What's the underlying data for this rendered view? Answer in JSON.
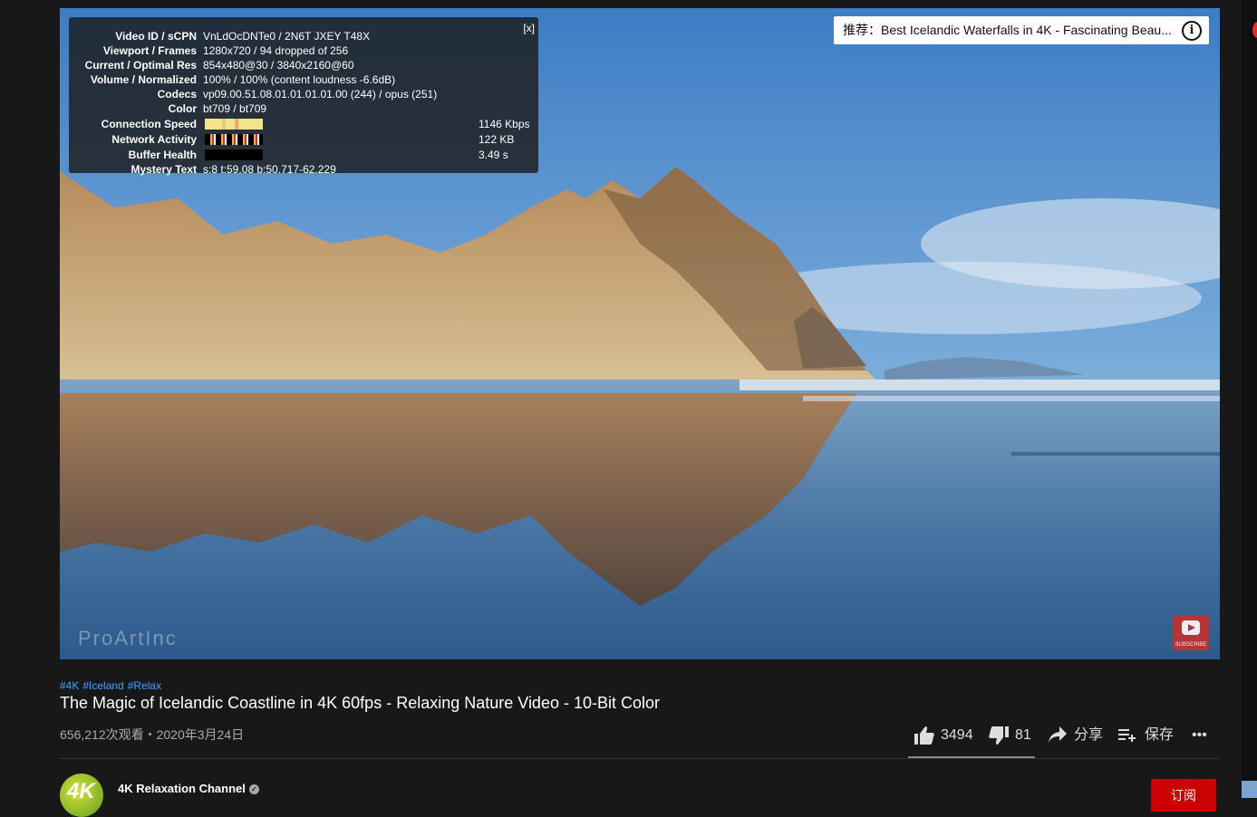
{
  "stats_panel": {
    "close_label": "[x]",
    "rows": [
      {
        "key": "Video ID / sCPN",
        "value": "VnLdOcDNTe0 / 2N6T JXEY T48X"
      },
      {
        "key": "Viewport / Frames",
        "value": "1280x720 / 94 dropped of 256"
      },
      {
        "key": "Current / Optimal Res",
        "value": "854x480@30 / 3840x2160@60"
      },
      {
        "key": "Volume / Normalized",
        "value": "100% / 100% (content loudness -6.6dB)"
      },
      {
        "key": "Codecs",
        "value": "vp09.00.51.08.01.01.01.01.00 (244) / opus (251)"
      },
      {
        "key": "Color",
        "value": "bt709 / bt709"
      },
      {
        "key": "Connection Speed",
        "value": "1146 Kbps"
      },
      {
        "key": "Network Activity",
        "value": "122 KB"
      },
      {
        "key": "Buffer Health",
        "value": "3.49 s"
      },
      {
        "key": "Mystery Text",
        "value": "s:8 t:59.08 b:50.717-62.229"
      }
    ]
  },
  "recommendation": {
    "text": "推荐：Best Icelandic Waterfalls in 4K - Fascinating Beau...",
    "info_icon": "i"
  },
  "watermark": "ProArtInc",
  "subscribe_badge": "SUBSCRIBE",
  "video": {
    "tags": [
      "#4K",
      "#Iceland",
      "#Relax"
    ],
    "title": "The Magic of Icelandic Coastline in 4K 60fps - Relaxing Nature Video - 10-Bit Color",
    "meta": "656,212次观看・2020年3月24日",
    "likes": "3494",
    "dislikes": "81",
    "share_label": "分享",
    "save_label": "保存",
    "more_label": "•••"
  },
  "channel": {
    "name": "4K Relaxation Channel",
    "avatar_text": "4K",
    "subscribe_label": "订阅"
  },
  "colors": {
    "accent_link": "#3ea6ff",
    "subscribe_red": "#cc0000",
    "background": "#181818"
  }
}
